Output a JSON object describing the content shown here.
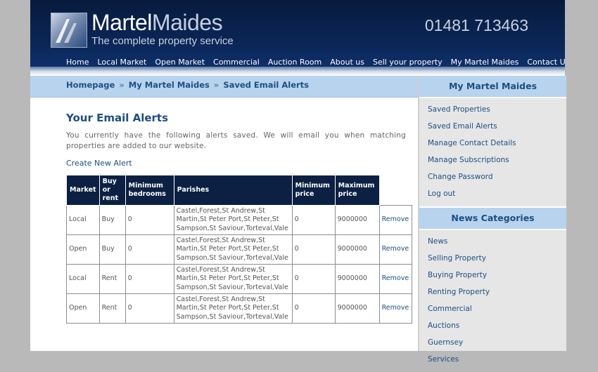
{
  "brand": {
    "name_part1": "Martel",
    "name_part2": "Maides",
    "tagline": "The complete property service",
    "phone": "01481 713463"
  },
  "nav": [
    "Home",
    "Local Market",
    "Open Market",
    "Commercial",
    "Auction Room",
    "About us",
    "Sell your property",
    "My Martel Maides",
    "Contact Us"
  ],
  "breadcrumb": [
    "Homepage",
    "My Martel Maides",
    "Saved Email Alerts"
  ],
  "breadcrumb_separator": "»",
  "main": {
    "title": "Your Email Alerts",
    "intro": "You currently have the following alerts saved. We will email you when matching properties are added to our website.",
    "create_link": "Create New Alert"
  },
  "table": {
    "headers": {
      "market": "Market",
      "buy_or_rent": "Buy or rent",
      "min_bedrooms": "Minimum bedrooms",
      "parishes": "Parishes",
      "min_price": "Minimum price",
      "max_price": "Maximum price"
    },
    "rows": [
      {
        "market": "Local",
        "type": "Buy",
        "bedrooms": "0",
        "parishes": "Castel,Forest,St Andrew,St Martin,St Peter Port,St Peter,St Sampson,St Saviour,Torteval,Vale",
        "min": "0",
        "max": "9000000",
        "action": "Remove"
      },
      {
        "market": "Open",
        "type": "Buy",
        "bedrooms": "0",
        "parishes": "Castel,Forest,St Andrew,St Martin,St Peter Port,St Peter,St Sampson,St Saviour,Torteval,Vale",
        "min": "0",
        "max": "9000000",
        "action": "Remove"
      },
      {
        "market": "Local",
        "type": "Rent",
        "bedrooms": "0",
        "parishes": "Castel,Forest,St Andrew,St Martin,St Peter Port,St Peter,St Sampson,St Saviour,Torteval,Vale",
        "min": "0",
        "max": "9000000",
        "action": "Remove"
      },
      {
        "market": "Open",
        "type": "Rent",
        "bedrooms": "0",
        "parishes": "Castel,Forest,St Andrew,St Martin,St Peter Port,St Peter,St Sampson,St Saviour,Torteval,Vale",
        "min": "0",
        "max": "9000000",
        "action": "Remove"
      }
    ]
  },
  "sidebar": {
    "account_title": "My Martel Maides",
    "account_items": [
      "Saved Properties",
      "Saved Email Alerts",
      "Manage Contact Details",
      "Manage Subscriptions",
      "Change Password",
      "Log out"
    ],
    "news_title": "News Categories",
    "news_items": [
      "News",
      "Selling Property",
      "Buying Property",
      "Renting Property",
      "Commercial",
      "Auctions",
      "Guernsey",
      "Services"
    ]
  },
  "colors": {
    "header_bg": "#0b2656",
    "accent_blue": "#1c4e83",
    "light_blue": "#b7d3ee",
    "table_header": "#0b2042",
    "sidebar_bg": "#e6e6e6"
  }
}
